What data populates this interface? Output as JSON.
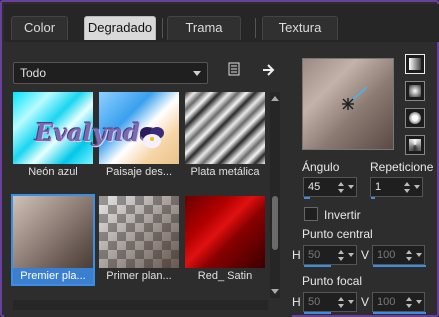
{
  "tabs": [
    {
      "label": "Color",
      "active": false
    },
    {
      "label": "Degradado",
      "active": true
    },
    {
      "label": "Trama",
      "active": false
    },
    {
      "label": "Textura",
      "active": false
    }
  ],
  "category_select": {
    "value": "Todo"
  },
  "icons": {
    "library": "library-icon",
    "export": "arrow-right-icon"
  },
  "gallery": [
    {
      "caption": "Neón azul",
      "selected": false
    },
    {
      "caption": "Paisaje des...",
      "selected": false
    },
    {
      "caption": "Plata metálica",
      "selected": false
    },
    {
      "caption": "Premier pla...",
      "selected": true
    },
    {
      "caption": "Primer plan...",
      "selected": false
    },
    {
      "caption": "Red_ Satin",
      "selected": false
    }
  ],
  "watermark": "Evalynda",
  "controls": {
    "angle_label": "Ángulo",
    "angle_value": "45",
    "repeats_label": "Repeticione",
    "repeats_value": "1",
    "invert_label": "Invertir",
    "center_label": "Punto central",
    "center_h_label": "H",
    "center_h_value": "50",
    "center_v_label": "V",
    "center_v_value": "100",
    "focal_label": "Punto focal",
    "focal_h_label": "H",
    "focal_h_value": "50",
    "focal_v_label": "V",
    "focal_v_value": "100"
  },
  "colors": {
    "accent": "#3b8fe0",
    "frame": "#6a3fa0"
  }
}
